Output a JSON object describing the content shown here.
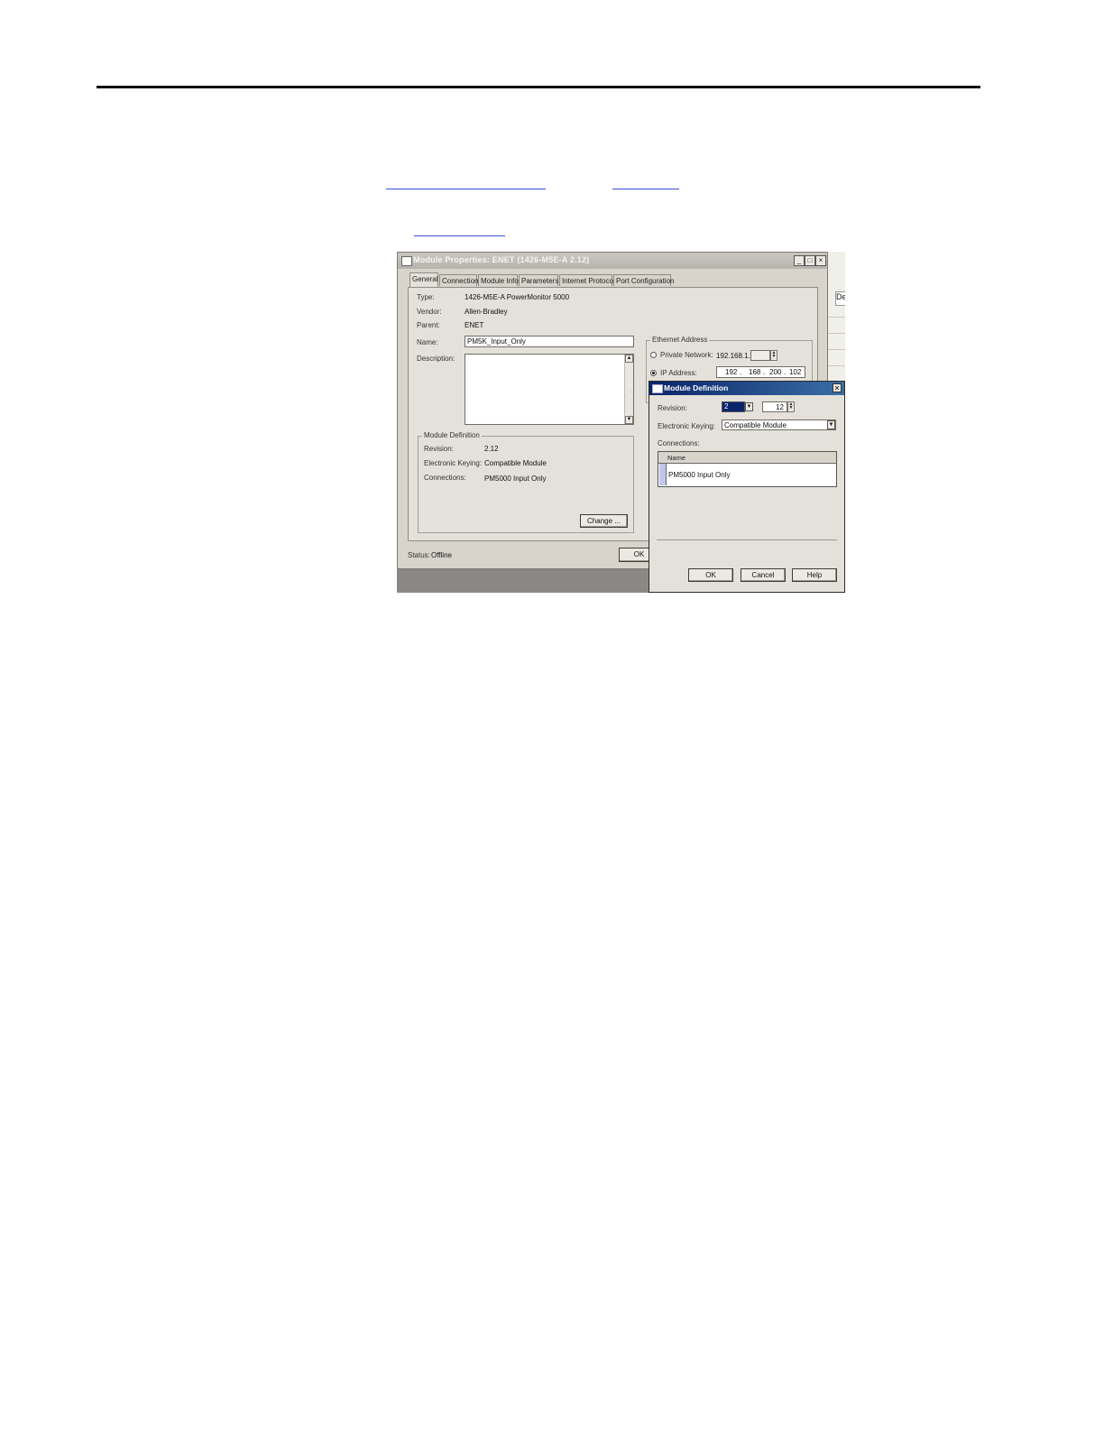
{
  "properties_window": {
    "title": "Module Properties: ENET (1426-M5E-A 2.12)",
    "tabs": [
      "General",
      "Connection",
      "Module Info",
      "Parameters",
      "Internet Protocol",
      "Port Configuration"
    ],
    "general": {
      "type_label": "Type:",
      "type_value": "1426-M5E-A PowerMonitor 5000",
      "vendor_label": "Vendor:",
      "vendor_value": "Allen-Bradley",
      "parent_label": "Parent:",
      "parent_value": "ENET",
      "name_label": "Name:",
      "name_value": "PM5K_Input_Only",
      "description_label": "Description:",
      "description_value": ""
    },
    "module_definition": {
      "title": "Module Definition",
      "revision_label": "Revision:",
      "revision_value": "2.12",
      "keying_label": "Electronic Keying:",
      "keying_value": "Compatible Module",
      "connections_label": "Connections:",
      "connections_value": "PM5000 Input Only",
      "change_button": "Change ..."
    },
    "ethernet_address": {
      "title": "Ethernet Address",
      "private_network_label": "Private Network:",
      "private_network_prefix": "192.168.1.",
      "ip_address_label": "IP Address:",
      "ip_octets": [
        "192",
        "168",
        "200",
        "102"
      ],
      "selected_option": "IP Address"
    },
    "status_label": "Status:",
    "status_value": "Offline",
    "ok_button": "OK"
  },
  "background_window": {
    "header_fragment": "De"
  },
  "module_definition_dialog": {
    "title": "Module Definition",
    "close_glyph": "✕",
    "revision_label": "Revision:",
    "revision_major": "2",
    "revision_minor": "12",
    "keying_label": "Electronic Keying:",
    "keying_value": "Compatible Module",
    "connections_label": "Connections:",
    "grid_header": "Name",
    "grid_rows": [
      "PM5000 Input Only"
    ],
    "ok_button": "OK",
    "cancel_button": "Cancel",
    "help_button": "Help"
  }
}
